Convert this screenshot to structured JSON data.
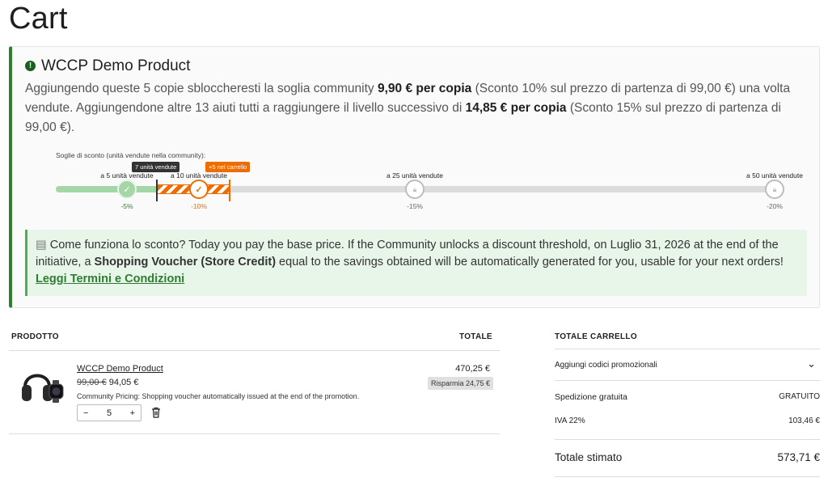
{
  "page": {
    "title": "Cart"
  },
  "notice": {
    "product": "WCCP Demo Product",
    "p1": "Aggiungendo queste 5 copie sbloccheresti la soglia community ",
    "p1_bold": "9,90 € per copia",
    "p2": " (Sconto 10% sul prezzo di partenza di 99,00 €) una volta vendute. Aggiungendone altre 13 aiuti tutti a raggiungere il livello successivo di ",
    "p2_bold": "14,85 € per copia",
    "p3": " (Sconto 15% sul prezzo di partenza di 99,00 €).",
    "thresholds_label": "Soglie di sconto (unità vendute nella community):",
    "sold_tag": "7 unità vendute",
    "cart_tag": "+5 nel carrello",
    "tiers": [
      {
        "label": "a 5 unità vendute",
        "pct": "-5%",
        "state": "done"
      },
      {
        "label": "a 10 unità vendute",
        "pct": "-10%",
        "state": "active"
      },
      {
        "label": "a 25 unità vendute",
        "pct": "-15%",
        "state": "locked"
      },
      {
        "label": "a 50 unità vendute",
        "pct": "-20%",
        "state": "locked"
      }
    ],
    "howto_q": "Come funziona lo sconto?",
    "howto_t1": " Today you pay the base price. If the Community unlocks a discount threshold, on Luglio 31, 2026 at the end of the initiative, a ",
    "howto_b": "Shopping Voucher (Store Credit)",
    "howto_t2": " equal to the savings obtained will be automatically generated for you, usable for your next orders! ",
    "howto_link": "Leggi Termini e Condizioni"
  },
  "table": {
    "col_product": "PRODOTTO",
    "col_total": "TOTALE",
    "item": {
      "name": "WCCP Demo Product",
      "old_price": "99,00 €",
      "price": "94,05 €",
      "note": "Community Pricing: Shopping voucher automatically issued at the end of the promotion.",
      "qty": "5",
      "minus": "−",
      "plus": "+",
      "line_total": "470,25 €",
      "savings": "Risparmia 24,75 €"
    }
  },
  "summary": {
    "title": "TOTALE CARRELLO",
    "promo": "Aggiungi codici promozionali",
    "shipping_label": "Spedizione gratuita",
    "shipping_value": "GRATUITO",
    "vat_label": "IVA 22%",
    "vat_value": "103,46 €",
    "total_label": "Totale stimato",
    "total_value": "573,71 €"
  },
  "colors": {
    "green": "#2e7d32",
    "orange": "#ef6c00",
    "light_green": "#a5d6a7"
  }
}
